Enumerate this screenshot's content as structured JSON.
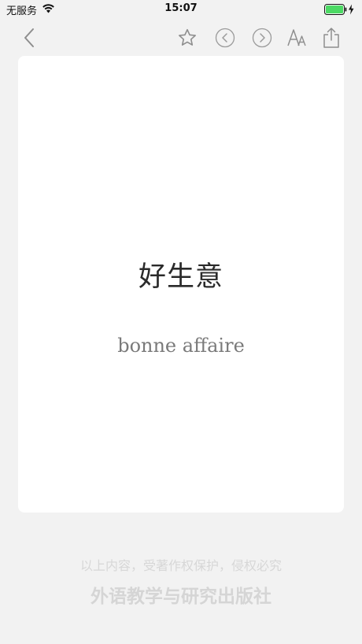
{
  "status_bar": {
    "carrier": "无服务",
    "time": "15:07",
    "battery_color": "#4cd964"
  },
  "toolbar": {
    "back_icon": "chevron-left-icon",
    "favorite_icon": "star-icon",
    "prev_icon": "circle-chevron-left-icon",
    "next_icon": "circle-chevron-right-icon",
    "font_size_icon": "font-size-icon",
    "share_icon": "share-icon",
    "icon_color": "#8e8e8e"
  },
  "card": {
    "term": "好生意",
    "translation": "bonne affaire"
  },
  "footer": {
    "copyright": "以上内容，受著作权保护，侵权必究",
    "publisher": "外语教学与研究出版社"
  }
}
